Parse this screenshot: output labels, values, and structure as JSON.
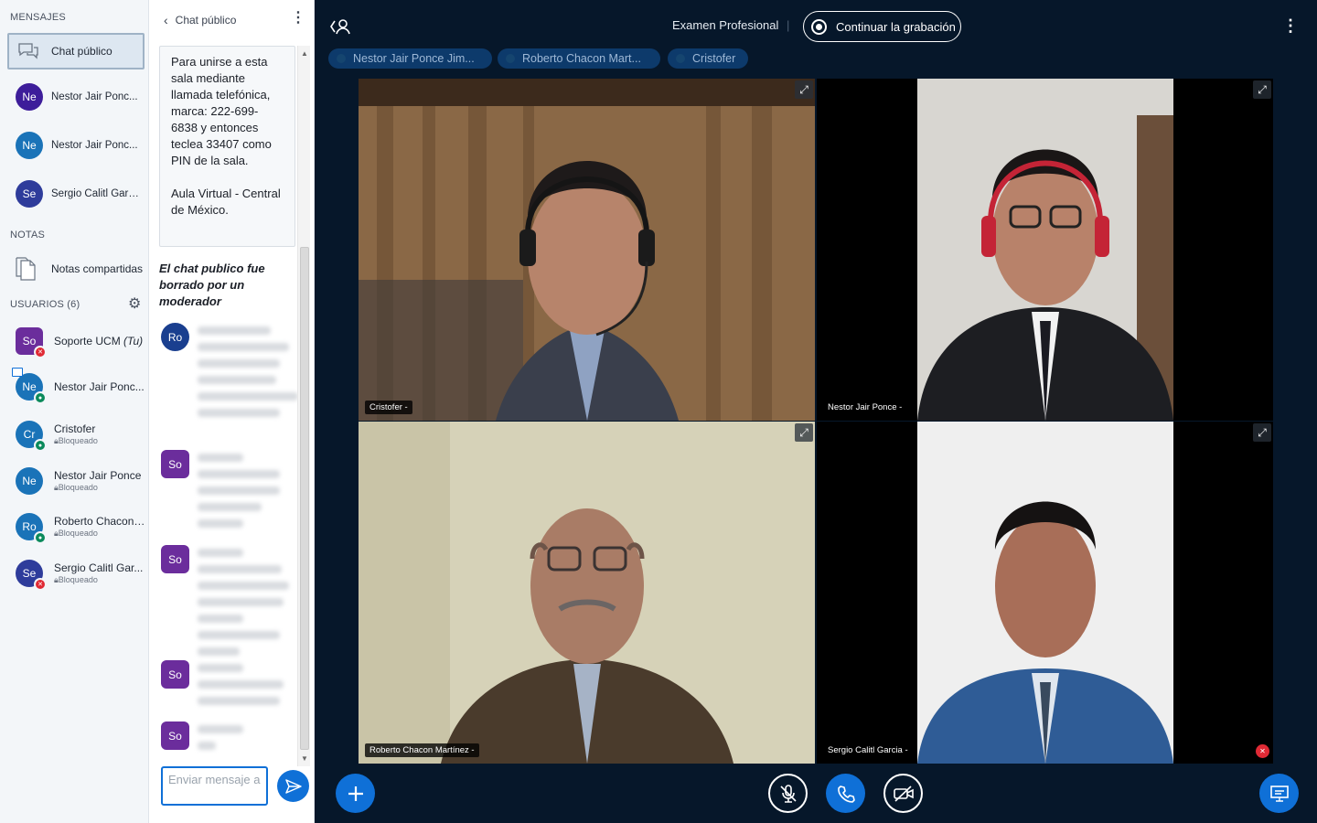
{
  "userlist": {
    "messages_title": "MENSAJES",
    "public_chat_label": "Chat público",
    "private_chats": [
      {
        "initials": "Ne",
        "name": "Nestor Jair Ponc...",
        "color": "#3d1d9a"
      },
      {
        "initials": "Ne",
        "name": "Nestor Jair Ponc...",
        "color": "#1a73b8"
      },
      {
        "initials": "Se",
        "name": "Sergio Calitl Garcia",
        "color": "#2e3c9b"
      }
    ],
    "notes_title": "NOTAS",
    "shared_notes_label": "Notas compartidas",
    "users_title": "USUARIOS (6)",
    "users": [
      {
        "initials": "So",
        "name": "Soporte UCM",
        "you_suffix": "(Tu)",
        "status": "",
        "color": "#6b2d9c",
        "badge": "muted"
      },
      {
        "initials": "Ne",
        "name": "Nestor Jair Ponc...",
        "status": "",
        "color": "#1a73b8",
        "badge": "mic"
      },
      {
        "initials": "Cr",
        "name": "Cristofer",
        "status": "Bloqueado",
        "color": "#1a73b8",
        "badge": "mic"
      },
      {
        "initials": "Ne",
        "name": "Nestor Jair Ponce",
        "status": "Bloqueado",
        "color": "#1a73b8",
        "badge": ""
      },
      {
        "initials": "Ro",
        "name": "Roberto Chacon ...",
        "status": "Bloqueado",
        "color": "#1a73b8",
        "badge": "mic"
      },
      {
        "initials": "Se",
        "name": "Sergio Calitl Gar...",
        "status": "Bloqueado",
        "color": "#2e3c9b",
        "badge": "muted"
      }
    ]
  },
  "chat": {
    "header_title": "Chat público",
    "welcome_text_1": "Para unirse a esta sala mediante llamada telefónica, marca: 222-699-6838 y entonces teclea 33407 como PIN de la sala.",
    "welcome_text_2": "Aula Virtual - Central de México.",
    "cleared_notice": "El chat publico fue borrado por un moderador",
    "messages": [
      {
        "initials": "Ro",
        "color": "#1a3f8f"
      },
      {
        "initials": "So",
        "color": "#6b2d9c"
      },
      {
        "initials": "So",
        "color": "#6b2d9c"
      },
      {
        "initials": "So",
        "color": "#6b2d9c"
      },
      {
        "initials": "So",
        "color": "#6b2d9c"
      }
    ],
    "input_placeholder": "Enviar mensaje a"
  },
  "main": {
    "meeting_title": "Examen Profesional",
    "record_label": "Continuar la grabación",
    "talkers": [
      "Nestor Jair Ponce Jim...",
      "Roberto Chacon Mart...",
      "Cristofer"
    ],
    "videos": [
      {
        "label": "Cristofer -"
      },
      {
        "label": "Nestor Jair Ponce -"
      },
      {
        "label": "Roberto Chacon Martínez -"
      },
      {
        "label": "Sergio Calitl Garcia -"
      }
    ]
  },
  "colors": {
    "accent": "#0f70d7",
    "muted_badge": "#e02a35",
    "mic_badge": "#0b8a5b"
  }
}
